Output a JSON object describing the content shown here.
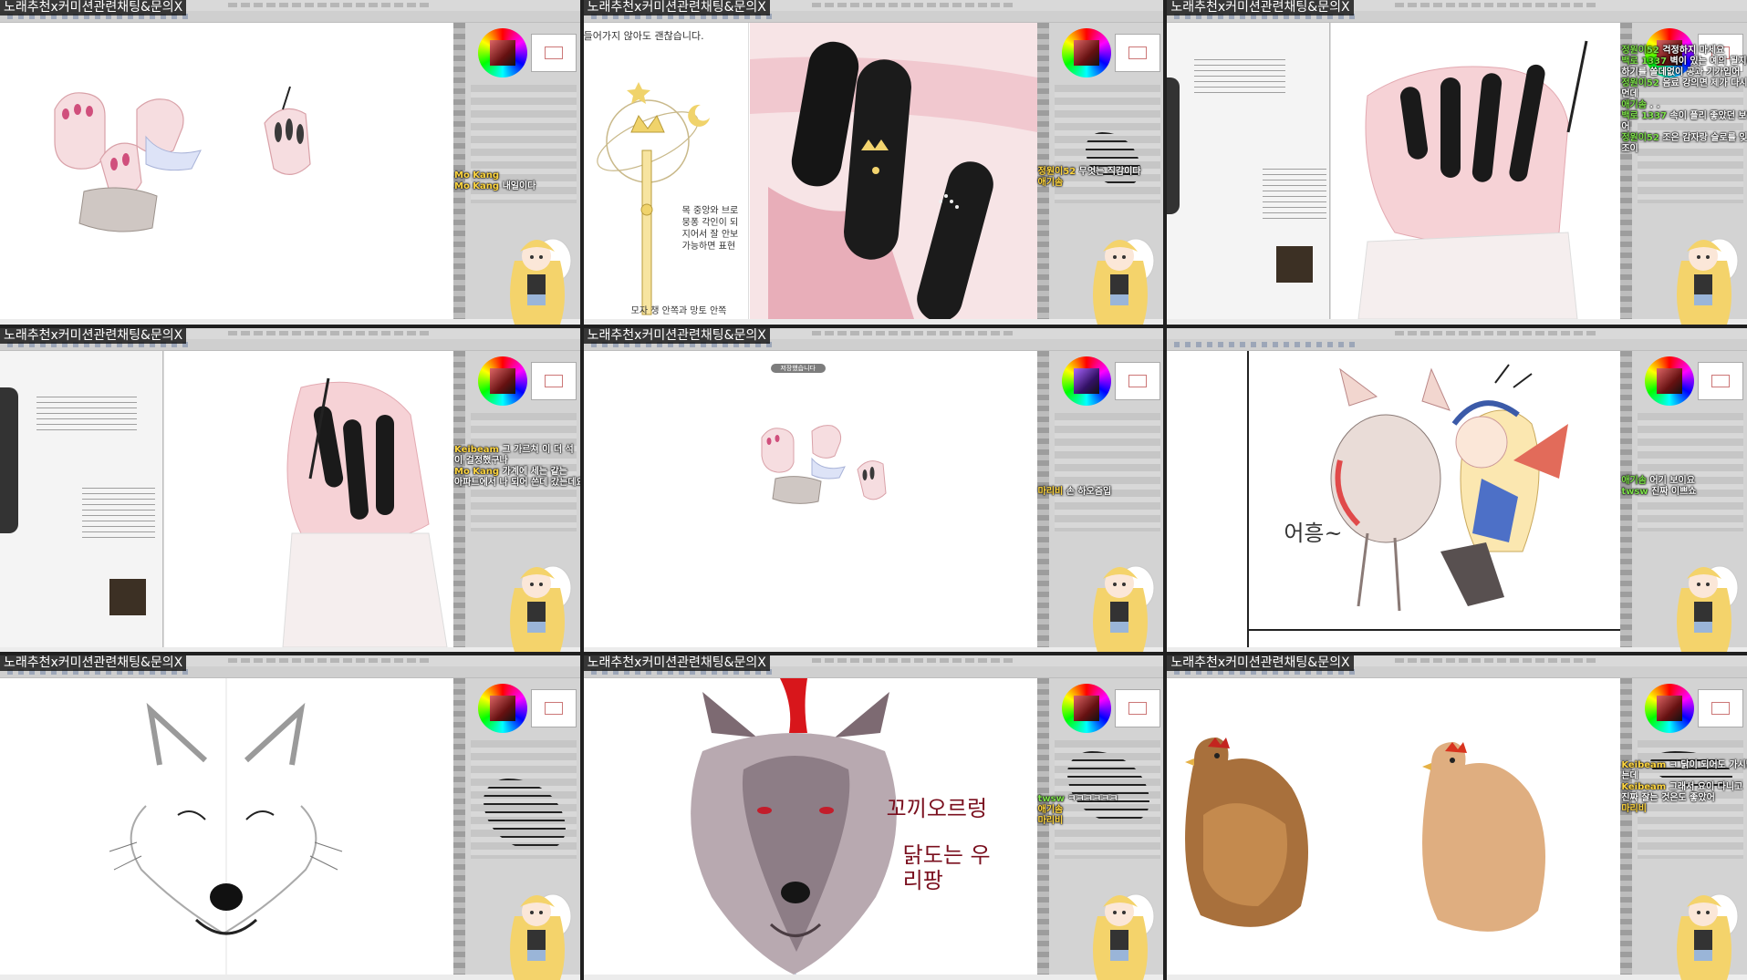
{
  "stream": {
    "title": "노래추천x커미션관련채팅&문의X"
  },
  "colors": {
    "chat_nick": "#ffd640",
    "chat_nick_alt": "#7de04a",
    "chat_msg": "#ffffff",
    "overlay_bg": "#141414"
  },
  "panels": [
    {
      "id": 1,
      "chat": [
        {
          "nick": "Mo Kang",
          "msg": ""
        },
        {
          "nick": "Mo Kang",
          "msg": "내일이다"
        }
      ]
    },
    {
      "id": 2,
      "caption_top": "들어가지 않아도 괜찮습니다.",
      "caption_mid": "목 중앙와 브로\n뭉퐁 각인이 되\n지어서 잘 안보\n가능하면 표현",
      "caption_bottom": "모자 챙 안쪽과 망토 안쪽",
      "chat": [
        {
          "nick": "정원이52",
          "msg": "무엇는 직감이다"
        },
        {
          "nick": "애기솜",
          "msg": ""
        }
      ]
    },
    {
      "id": 3,
      "chat": [
        {
          "nick": "정원이52",
          "msg": "걱정하지 마세요"
        },
        {
          "nick": "백로 1337",
          "msg": "벽이 있는 예의 될지라가능"
        },
        {
          "nick": "",
          "msg": "하기를 쓸데없이 공과 기가입어"
        },
        {
          "nick": "정원이52",
          "msg": "음료 강의면 제가 다시"
        },
        {
          "nick": "",
          "msg": "먼데"
        },
        {
          "nick": "애기솜",
          "msg": ". ."
        },
        {
          "nick": "백로 1337",
          "msg": "속이 플리 좋았던 보일"
        },
        {
          "nick": "",
          "msg": "어"
        },
        {
          "nick": "정원이52",
          "msg": "조은 감자랑 슬로를 잊"
        },
        {
          "nick": "",
          "msg": "조이"
        }
      ]
    },
    {
      "id": 4,
      "chat": [
        {
          "nick": "Keibeam",
          "msg": "그 가르쳐 이 더 석"
        },
        {
          "nick": "",
          "msg": "이 걸정했구나"
        },
        {
          "nick": "Mo Kang",
          "msg": "가계에 세는 같는"
        },
        {
          "nick": "",
          "msg": "아파트에서 나 되어 쓴데 갔는데요"
        }
      ]
    },
    {
      "id": 5,
      "notice": "저장했습니다",
      "chat": [
        {
          "nick": "마리비",
          "msg": "손 하오즘입"
        }
      ]
    },
    {
      "id": 6,
      "sketch_text": "어흥~",
      "chat": [
        {
          "nick": "애기솜",
          "msg": "어기 보이요"
        },
        {
          "nick": "twsw",
          "msg": "진짜 이쁘쇼"
        }
      ]
    },
    {
      "id": 7,
      "chat": []
    },
    {
      "id": 8,
      "art_text_1": "꼬끼오르렁",
      "art_text_2": "닭도는 우리팡",
      "chat": [
        {
          "nick": "twsw",
          "msg": "ㅋㅋㅋㅋㅋㅋ"
        },
        {
          "nick": "애기솜",
          "msg": ""
        },
        {
          "nick": "마리비",
          "msg": ""
        }
      ]
    },
    {
      "id": 9,
      "chat": [
        {
          "nick": "Keibeam",
          "msg": "ㅋ 닭이 되어도 가시망"
        },
        {
          "nick": "",
          "msg": "는데"
        },
        {
          "nick": "Keibeam",
          "msg": "그래서 요이 다니고"
        },
        {
          "nick": "",
          "msg": "진짜 잘는 것은도 좋았어"
        },
        {
          "nick": "마리비",
          "msg": ""
        }
      ]
    }
  ]
}
